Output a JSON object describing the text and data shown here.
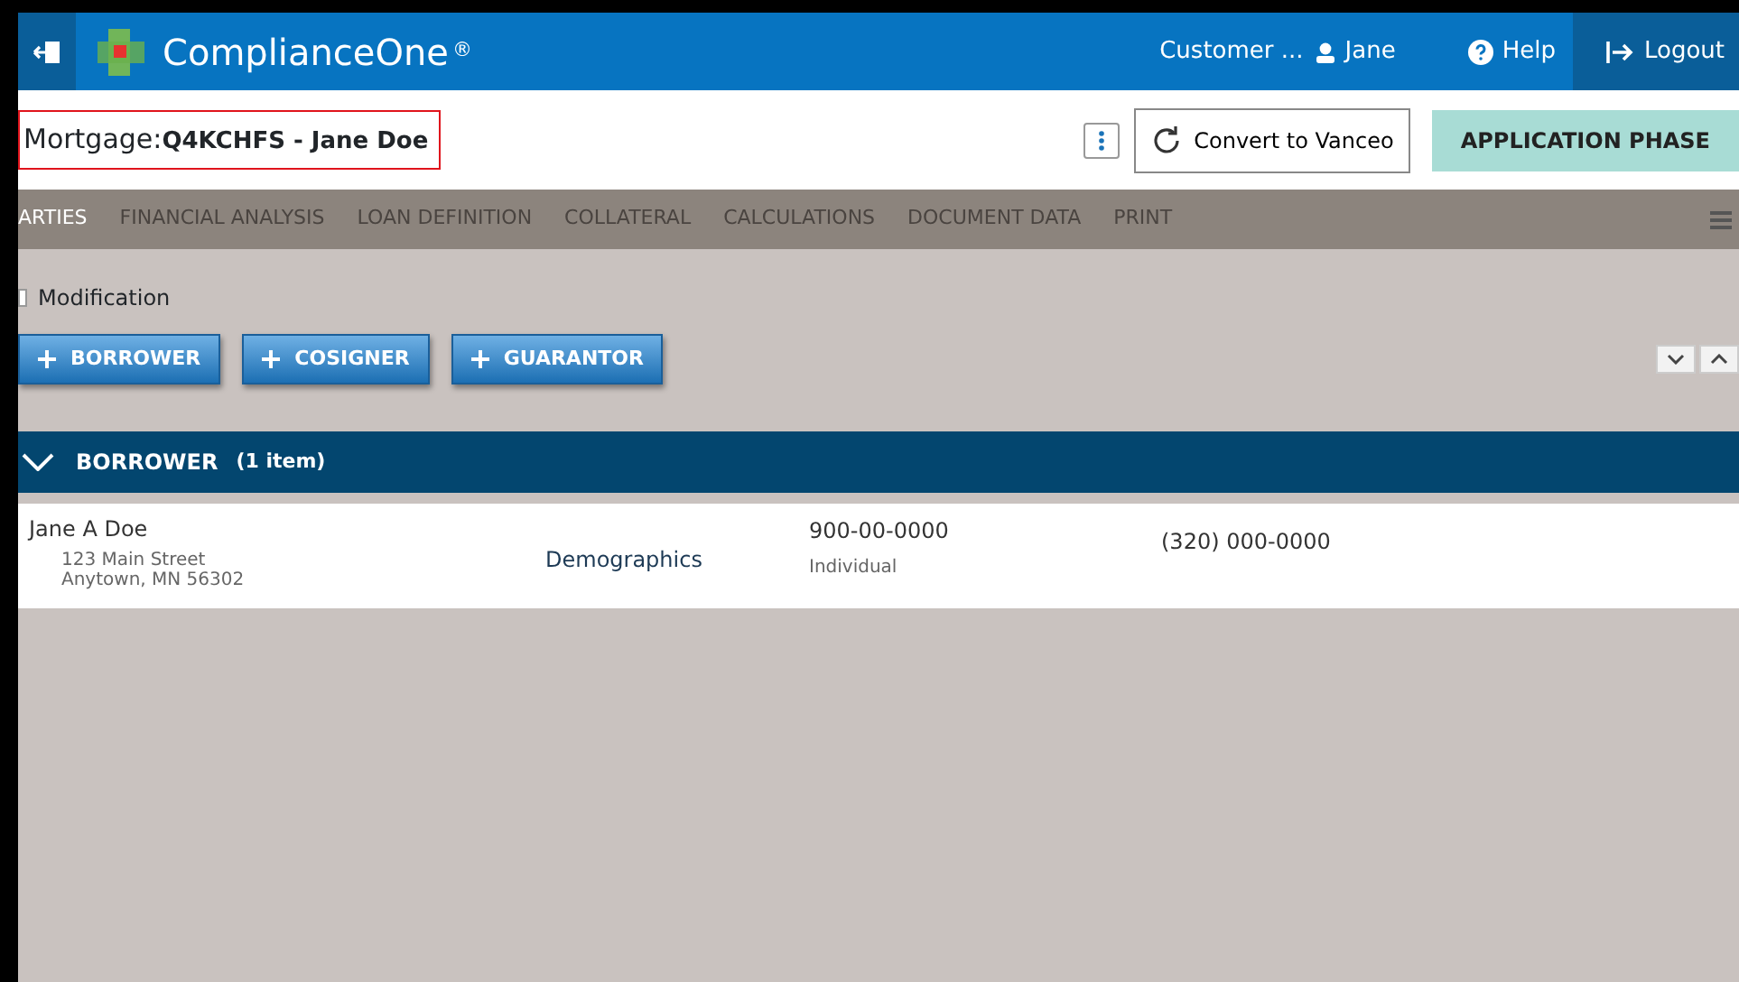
{
  "header": {
    "app_name": "ComplianceOne",
    "trademark": "®",
    "customer": "Customer ...",
    "user": "Jane",
    "help": "Help",
    "logout": "Logout"
  },
  "title_bar": {
    "label": "Mortgage:",
    "record": "Q4KCHFS - Jane Doe",
    "convert_button": "Convert to Vanceo",
    "phase_button": "APPLICATION PHASE"
  },
  "tabs": [
    {
      "label": "ARTIES",
      "selected": true
    },
    {
      "label": "FINANCIAL ANALYSIS",
      "selected": false
    },
    {
      "label": "LOAN DEFINITION",
      "selected": false
    },
    {
      "label": "COLLATERAL",
      "selected": false
    },
    {
      "label": "CALCULATIONS",
      "selected": false
    },
    {
      "label": "DOCUMENT DATA",
      "selected": false
    },
    {
      "label": "PRINT",
      "selected": false
    }
  ],
  "modification": {
    "label": "Modification",
    "checked": false
  },
  "add_buttons": [
    "BORROWER",
    "COSIGNER",
    "GUARANTOR"
  ],
  "section": {
    "title": "BORROWER",
    "count": "(1 item)",
    "expanded": true
  },
  "rows": [
    {
      "name": "Jane A Doe",
      "street": "123 Main Street",
      "city": "Anytown,  MN  56302",
      "link": "Demographics",
      "ssn": "900-00-0000",
      "type": "Individual",
      "phone": "(320) 000-0000"
    }
  ]
}
